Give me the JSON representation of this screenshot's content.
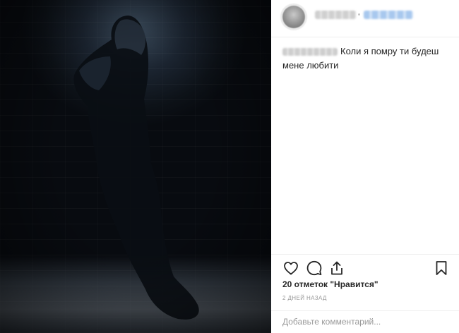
{
  "post": {
    "photo_alt": "Hooded figure in a dark alley",
    "caption_text": "Коли я помру ти будеш мене любити",
    "likes_text": "20 отметок \"Нравится\"",
    "time_text": "2 ДНЕЙ НАЗАД",
    "comment_placeholder": "Добавьте комментарий..."
  },
  "icons": {
    "like": "heart-icon",
    "comment": "comment-bubble-icon",
    "share": "share-icon",
    "save": "bookmark-icon"
  },
  "colors": {
    "text": "#262626",
    "muted": "#999999",
    "divider": "#efefef",
    "link_blue": "#3897f0"
  }
}
